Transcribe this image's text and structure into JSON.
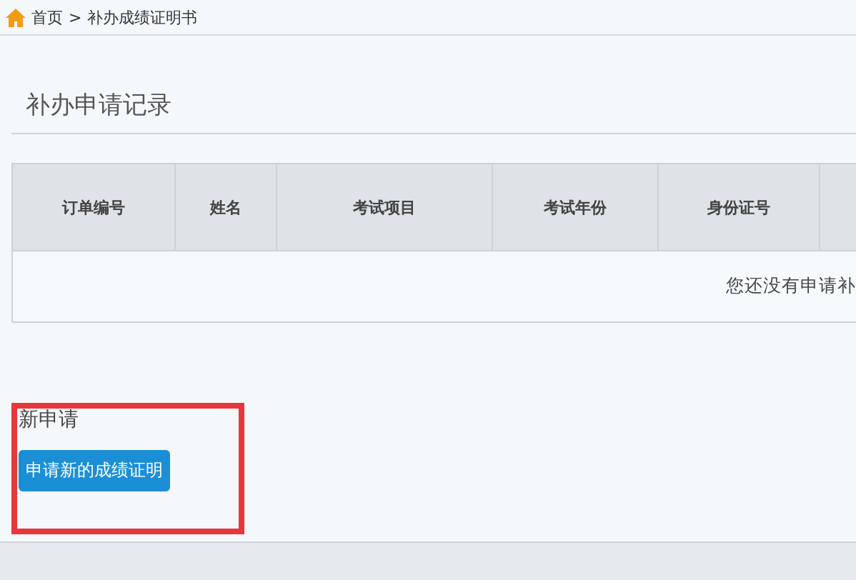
{
  "breadcrumb": {
    "home": "首页",
    "separator": ">",
    "current": "补办成绩证明书"
  },
  "records": {
    "title": "补办申请记录",
    "table": {
      "columns": [
        "订单编号",
        "姓名",
        "考试项目",
        "考试年份",
        "身份证号"
      ],
      "empty_message": "您还没有申请补"
    }
  },
  "new_application": {
    "title": "新申请",
    "button": "申请新的成绩证明"
  }
}
